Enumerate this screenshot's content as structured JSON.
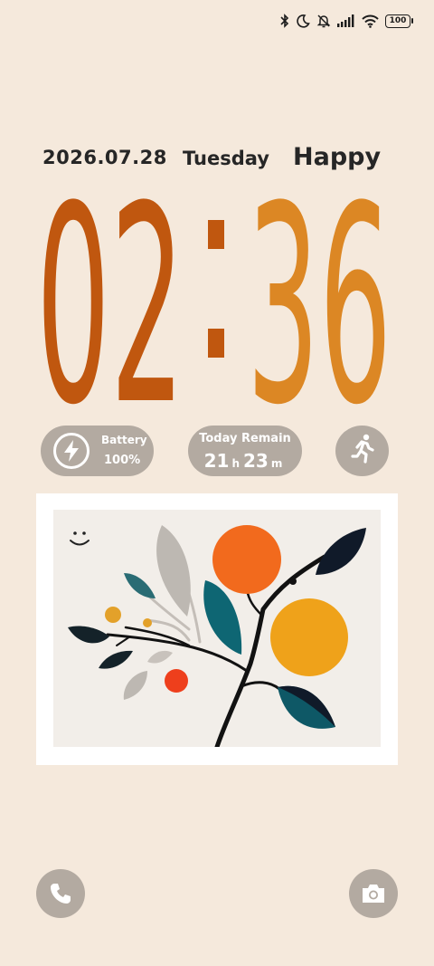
{
  "status_bar": {
    "icons": [
      "bluetooth-icon",
      "moon-icon",
      "bell-off-icon",
      "signal-icon",
      "wifi-icon"
    ],
    "battery": "100"
  },
  "lockscreen": {
    "date": "2026.07.28",
    "weekday": "Tuesday",
    "greeting": "Happy",
    "clock": {
      "hours": "02",
      "separator": ":",
      "minutes": "36"
    },
    "colors": {
      "hours": "#c0570f",
      "minutes": "#dc8724",
      "separator": "#c0570f"
    }
  },
  "widgets": {
    "battery": {
      "label": "Battery",
      "value": "100%",
      "icon": "lightning-icon"
    },
    "remain": {
      "label": "Today Remain",
      "hours": "21",
      "hours_unit": "h",
      "minutes": "23",
      "minutes_unit": "m"
    },
    "activity": {
      "icon": "running-icon"
    }
  },
  "artwork": {
    "icon": "smiley-icon",
    "colors": {
      "orange": "#f26a1d",
      "amber": "#efa21a",
      "teal": "#0e6673",
      "navy": "#101a29",
      "grey": "#bdb8b2",
      "red": "#ee3f1c"
    }
  },
  "shortcuts": {
    "left": "phone-icon",
    "right": "camera-icon"
  }
}
